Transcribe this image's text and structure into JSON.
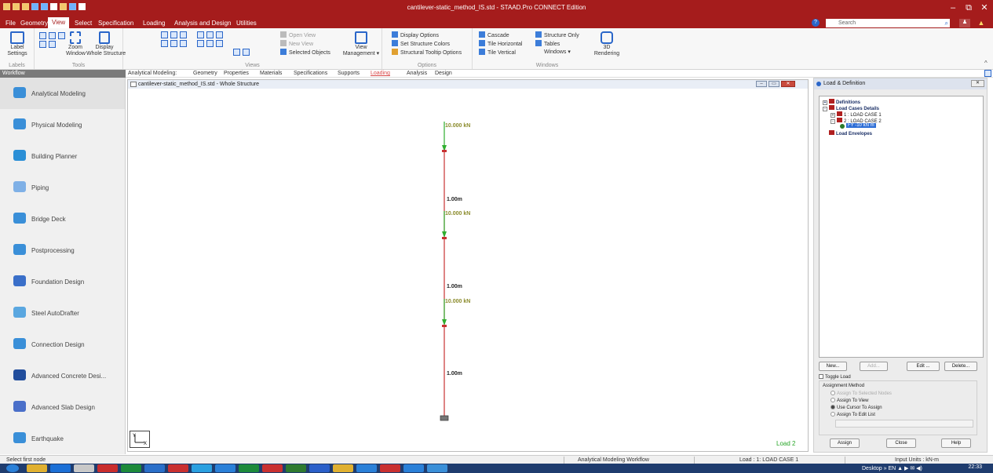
{
  "app": {
    "title": "cantilever-static_method_IS.std - STAAD.Pro CONNECT Edition",
    "search_placeholder": "Search",
    "minimize": "–",
    "maximize": "⧉",
    "close": "✕",
    "help": "?",
    "account": "♟",
    "notify": "▲"
  },
  "menu": {
    "tabs": [
      "File",
      "Geometry",
      "View",
      "Select",
      "Specification",
      "Loading",
      "Analysis and Design",
      "Utilities"
    ],
    "active": "View"
  },
  "ribbon": {
    "labels_group": {
      "label": "Labels",
      "button": "Label\nSettings"
    },
    "tools_group": {
      "label": "Tools",
      "zoom": "Zoom\nWindow",
      "display": "Display\nWhole Structure"
    },
    "views_group": {
      "label": "Views",
      "open_view": "Open View",
      "new_view": "New View",
      "selected_objects": "Selected Objects",
      "view_management": "View\nManagement ▾"
    },
    "options_group": {
      "label": "Options",
      "display_options": "Display Options",
      "set_structure_colors": "Set Structure Colors",
      "structural_tooltip": "Structural Tooltip Options"
    },
    "windows_group": {
      "label": "Windows",
      "cascade": "Cascade",
      "tile_horizontal": "Tile Horizontal",
      "tile_vertical": "Tile Vertical",
      "structure_only": "Structure Only",
      "tables": "Tables",
      "windows": "Windows ▾",
      "rendering": "3D\nRendering"
    }
  },
  "workflow": {
    "header": "Workflow",
    "items": [
      "Analytical Modeling",
      "Physical Modeling",
      "Building Planner",
      "Piping",
      "Bridge Deck",
      "Postprocessing",
      "Foundation Design",
      "Steel AutoDrafter",
      "Connection Design",
      "Advanced Concrete Desi...",
      "Advanced Slab Design",
      "Earthquake"
    ],
    "colors": [
      "#3a8fd8",
      "#3a8fd8",
      "#2b8fd6",
      "#7fb0e6",
      "#3a8fd8",
      "#3a8fd8",
      "#3a6fc9",
      "#5aa7e0",
      "#3a8fd8",
      "#214d9c",
      "#4a6fc9",
      "#3a8fd8"
    ]
  },
  "page_tabs": {
    "items": [
      "Analytical Modeling:",
      "Geometry",
      "Properties",
      "Materials",
      "Specifications",
      "Supports",
      "Loading",
      "Analysis",
      "Design"
    ],
    "active": "Loading"
  },
  "viewport": {
    "title": "cantilever-static_method_IS.std - Whole Structure",
    "load_indicator": "Load 2",
    "axis_label": "Y\n└X",
    "loads": [
      "10.000 kN",
      "10.000 kN",
      "10.000 kN"
    ],
    "dimensions": [
      "1.00m",
      "1.00m",
      "1.00m"
    ]
  },
  "right_panel": {
    "title": "Load & Definition",
    "close_btn": "✕",
    "tree": {
      "definitions": "Definitions",
      "load_cases_details": "Load Cases Details",
      "load_case_1": "1 : LOAD CASE 1",
      "load_case_2": "2 : LOAD CASE 2",
      "selected_load": "FY -10 kN m",
      "load_envelopes": "Load Envelopes"
    },
    "buttons": {
      "new": "New...",
      "add": "Add...",
      "edit": "Edit ...",
      "delete": "Delete..."
    },
    "toggle_load": "Toggle Load",
    "assignment_method": "Assignment Method",
    "radios": [
      "Assign To Selected Nodes",
      "Assign To View",
      "Use Cursor To Assign",
      "Assign To Edit List"
    ],
    "radio_selected": 2,
    "footer_buttons": {
      "assign": "Assign",
      "close": "Close",
      "help": "Help"
    }
  },
  "status": {
    "left": "Select first node",
    "workflow": "Analytical Modeling Workflow",
    "load": "Load : 1: LOAD CASE 1",
    "units": "Input Units : kN-m"
  },
  "taskbar": {
    "tray": "Desktop  »  EN  ▲  ▶  ✉  ◀)",
    "clock": "22:33",
    "colors": [
      "#2a80d8",
      "#e0b030",
      "#1b6fd6",
      "#c8c8c8",
      "#c92d2d",
      "#1d8a3a",
      "#2a6fc9",
      "#c93030",
      "#2aa0e0",
      "#2a80d8",
      "#1d8a3a",
      "#c93030",
      "#2f7a2f",
      "#2a5fc9",
      "#e0b030",
      "#2a80d8",
      "#c93030",
      "#2a80d8",
      "#3a8fd8"
    ]
  }
}
